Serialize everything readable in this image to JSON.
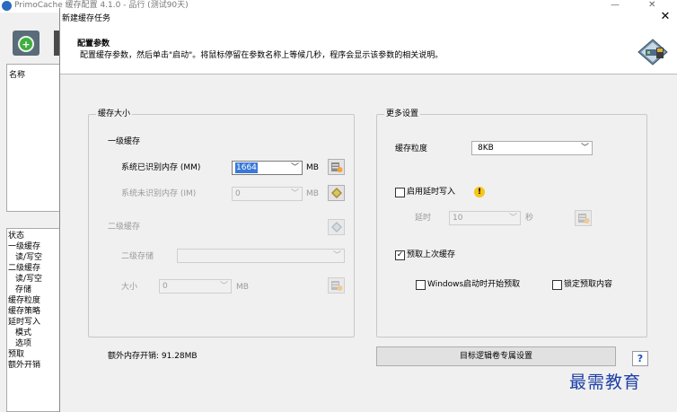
{
  "background_window": {
    "title": "PrimoCache 缓存配置 4.1.0 - 品行 (测试90天)",
    "list1_header": "名称",
    "list2_rows": [
      "状态",
      "一级缓存",
      "读/写空",
      "二级缓存",
      "读/写空",
      "存储",
      "缓存粒度",
      "缓存策略",
      "延时写入",
      "模式",
      "选项",
      "预取",
      "额外开销"
    ]
  },
  "dialog": {
    "title": "新建缓存任务",
    "close": "✕",
    "header": {
      "title": "配置参数",
      "description": "配置缓存参数，然后单击\"启动\"。将鼠标停留在参数名称上等候几秒，程序会显示该参数的相关说明。"
    },
    "cache_size": {
      "legend": "缓存大小",
      "level1": {
        "title": "一级缓存",
        "recognized_label": "系统已识别内存 (MM)",
        "recognized_value": "1664",
        "recognized_unit": "MB",
        "unrecognized_label": "系统未识别内存 (IM)",
        "unrecognized_value": "0",
        "unrecognized_unit": "MB"
      },
      "level2": {
        "title": "二级缓存",
        "storage_label": "二级存储",
        "storage_value": "",
        "size_label": "大小",
        "size_value": "0",
        "size_unit": "MB"
      }
    },
    "more_settings": {
      "legend": "更多设置",
      "granularity_label": "缓存粒度",
      "granularity_value": "8KB",
      "deferred_write": {
        "label": "启用延时写入",
        "checked": false,
        "warning": "!",
        "latency_label": "延时",
        "latency_value": "10",
        "latency_unit": "秒"
      },
      "prefetch": {
        "label": "预取上次缓存",
        "checked": true,
        "on_windows_start_label": "Windows启动时开始预取",
        "on_windows_start_checked": false,
        "lock_content_label": "锁定预取内容",
        "lock_content_checked": false
      }
    },
    "overhead_label": "额外内存开销: 91.28MB",
    "target_volume_button": "目标逻辑卷专属设置",
    "help_label": "?"
  },
  "watermark": "最需教育",
  "colors": {
    "selection": "#3b78d8",
    "help_icon": "#1e4fc2",
    "warning": "#f5c518",
    "watermark": "#1c3fa5"
  }
}
